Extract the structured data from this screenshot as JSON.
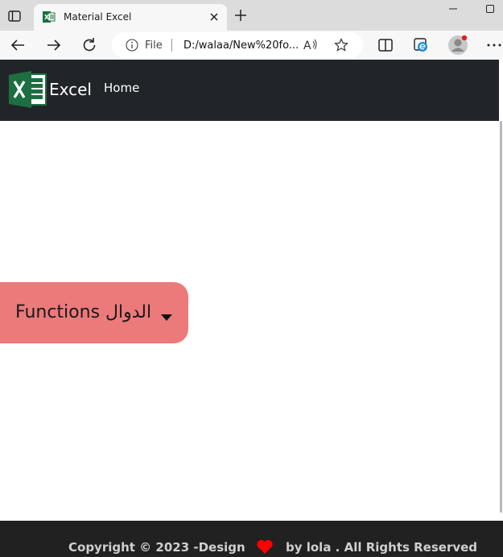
{
  "browser": {
    "tab": {
      "title": "Material Excel"
    },
    "address": {
      "scheme": "File",
      "url": "D:/walaa/New%20fo..."
    }
  },
  "navbar": {
    "brand": "Excel",
    "links": [
      {
        "label": "Home"
      }
    ]
  },
  "main": {
    "dropdown_label": "Functions الدوال"
  },
  "footer": {
    "left_text": "Copyright © 2023 -Design",
    "right_text": "by lola . All Rights Reserved"
  },
  "colors": {
    "navbar_bg": "#212529",
    "dropdown_bg": "#ec7a7a",
    "footer_bg": "#212121",
    "heart": "#ff0000",
    "excel_green": "#1d6f42"
  },
  "icons": [
    "tab-actions-icon",
    "excel-favicon-icon",
    "close-icon",
    "plus-icon",
    "minimize-icon",
    "maximize-icon",
    "back-arrow-icon",
    "forward-arrow-icon",
    "refresh-icon",
    "info-icon",
    "read-aloud-icon",
    "star-icon",
    "split-screen-icon",
    "edge-collections-icon",
    "profile-avatar-icon",
    "more-dots-icon",
    "excel-logo-icon",
    "caret-down-icon",
    "heart-icon"
  ]
}
